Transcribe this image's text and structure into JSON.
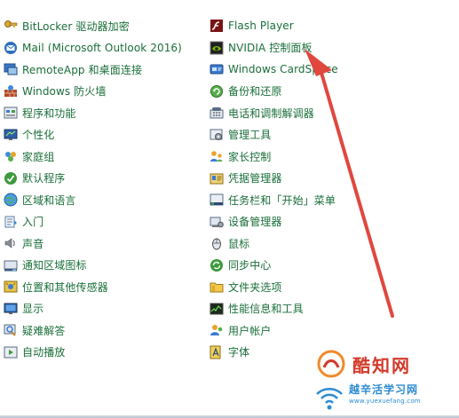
{
  "left_items": [
    {
      "label": "BitLocker 驱动器加密",
      "icon": "bitlocker-key-icon"
    },
    {
      "label": "Mail (Microsoft Outlook 2016)",
      "icon": "mail-icon"
    },
    {
      "label": "RemoteApp 和桌面连接",
      "icon": "remoteapp-icon"
    },
    {
      "label": "Windows 防火墙",
      "icon": "firewall-icon"
    },
    {
      "label": "程序和功能",
      "icon": "programs-icon"
    },
    {
      "label": "个性化",
      "icon": "personalization-icon"
    },
    {
      "label": "家庭组",
      "icon": "homegroup-icon"
    },
    {
      "label": "默认程序",
      "icon": "default-programs-icon"
    },
    {
      "label": "区域和语言",
      "icon": "region-globe-icon"
    },
    {
      "label": "入门",
      "icon": "getting-started-icon"
    },
    {
      "label": "声音",
      "icon": "speaker-icon"
    },
    {
      "label": "通知区域图标",
      "icon": "notification-icon"
    },
    {
      "label": "位置和其他传感器",
      "icon": "sensor-icon"
    },
    {
      "label": "显示",
      "icon": "display-icon"
    },
    {
      "label": "疑难解答",
      "icon": "troubleshoot-icon"
    },
    {
      "label": "自动播放",
      "icon": "autoplay-icon"
    }
  ],
  "right_items": [
    {
      "label": "Flash Player",
      "icon": "flash-icon"
    },
    {
      "label": "NVIDIA 控制面板",
      "icon": "nvidia-icon"
    },
    {
      "label": "Windows CardSpace",
      "icon": "cardspace-icon"
    },
    {
      "label": "备份和还原",
      "icon": "backup-icon"
    },
    {
      "label": "电话和调制解调器",
      "icon": "phone-modem-icon"
    },
    {
      "label": "管理工具",
      "icon": "admin-tools-icon"
    },
    {
      "label": "家长控制",
      "icon": "parental-control-icon"
    },
    {
      "label": "凭据管理器",
      "icon": "credential-icon"
    },
    {
      "label": "任务栏和「开始」菜单",
      "icon": "taskbar-icon"
    },
    {
      "label": "设备管理器",
      "icon": "device-manager-icon"
    },
    {
      "label": "鼠标",
      "icon": "mouse-icon"
    },
    {
      "label": "同步中心",
      "icon": "sync-icon"
    },
    {
      "label": "文件夹选项",
      "icon": "folder-icon"
    },
    {
      "label": "性能信息和工具",
      "icon": "performance-icon"
    },
    {
      "label": "用户帐户",
      "icon": "user-accounts-icon"
    },
    {
      "label": "字体",
      "icon": "fonts-icon"
    }
  ],
  "watermark": {
    "title": "酷知网",
    "subtitle": "越辛活学习网",
    "url": "www.yuexuefang.com"
  },
  "colors": {
    "link": "#1a6e3a",
    "arrow": "#e0473d",
    "watermark_red": "#d23a2a",
    "watermark_blue": "#2d8bd1"
  }
}
